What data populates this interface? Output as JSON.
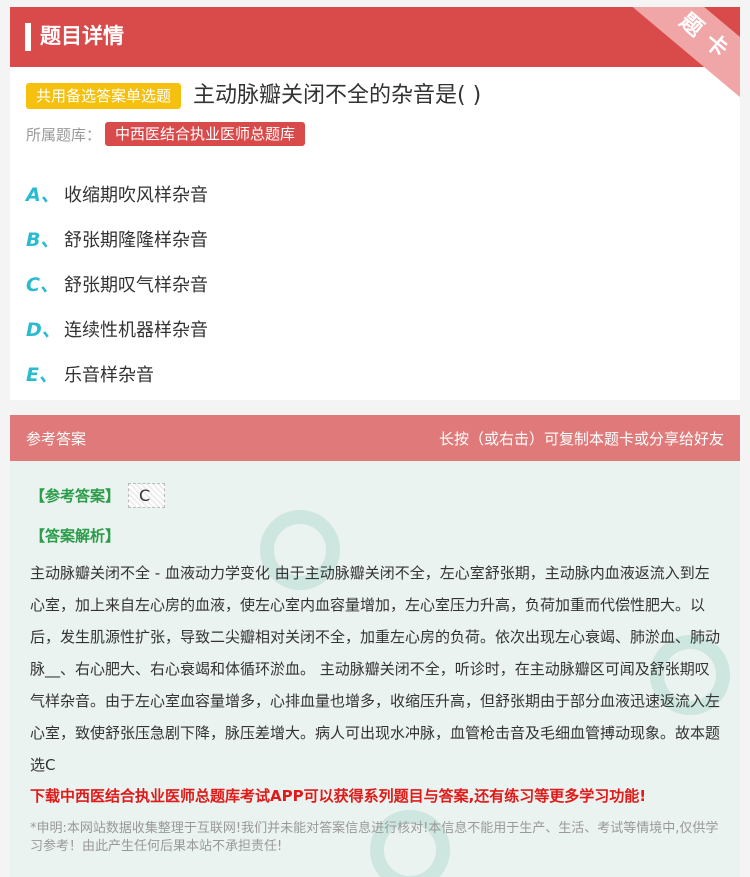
{
  "header": {
    "title": "题目详情",
    "ribbon": "题卡"
  },
  "question": {
    "type": "共用备选答案单选题",
    "text": "主动脉瓣关闭不全的杂音是( )",
    "library_label": "所属题库：",
    "library": "中西医结合执业医师总题库"
  },
  "options": [
    {
      "letter": "A、",
      "text": "收缩期吹风样杂音"
    },
    {
      "letter": "B、",
      "text": "舒张期隆隆样杂音"
    },
    {
      "letter": "C、",
      "text": "舒张期叹气样杂音"
    },
    {
      "letter": "D、",
      "text": "连续性机器样杂音"
    },
    {
      "letter": "E、",
      "text": "乐音样杂音"
    }
  ],
  "answer_section": {
    "title": "参考答案",
    "copy_hint": "长按（或右击）可复制本题卡或分享给好友",
    "answer_label": "【参考答案】",
    "answer_value": "C",
    "analysis_label": "【答案解析】",
    "analysis": "主动脉瓣关闭不全 - 血液动力学变化 由于主动脉瓣关闭不全，左心室舒张期，主动脉内血液返流入到左心室，加上来自左心房的血液，使左心室内血容量增加，左心室压力升高，负荷加重而代偿性肥大。以后，发生肌源性扩张，导致二尖瓣相对关闭不全，加重左心房的负荷。依次出现左心衰竭、肺淤血、肺动脉__、右心肥大、右心衰竭和体循环淤血。 主动脉瓣关闭不全，听诊时，在主动脉瓣区可闻及舒张期叹气样杂音。由于左心室血容量增多，心排血量也增多，收缩压升高，但舒张期由于部分血液迅速返流入左心室，致使舒张压急剧下降，脉压差增大。病人可出现水冲脉，血管枪击音及毛细血管搏动现象。故本题选C",
    "promo": "下载中西医结合执业医师总题库考试APP可以获得系列题目与答案,还有练习等更多学习功能!",
    "disclaimer": "*申明:本网站数据收集整理于互联网!我们并未能对答案信息进行核对!本信息不能用于生产、生活、考试等情境中,仅供学习参考！由此产生任何后果本站不承担责任!"
  }
}
